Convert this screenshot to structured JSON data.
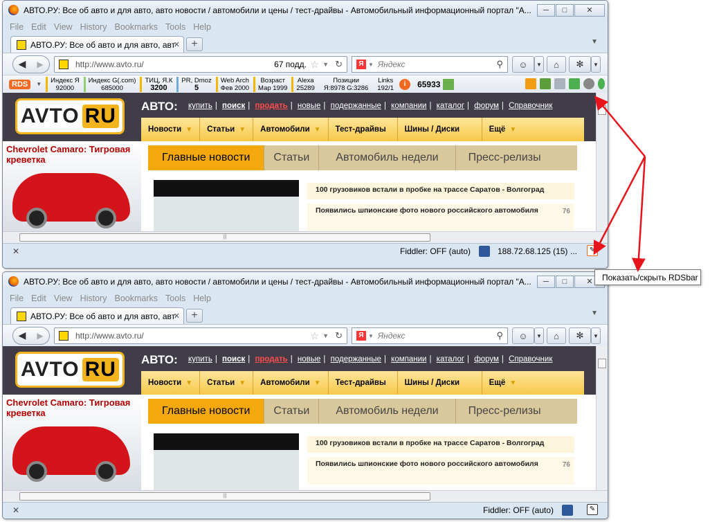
{
  "window_title": "АВТО.РУ: Все об авто и для авто, авто новости / автомобили и цены / тест-драйвы - Автомобильный информационный портал \"А...",
  "menu": [
    "File",
    "Edit",
    "View",
    "History",
    "Bookmarks",
    "Tools",
    "Help"
  ],
  "tab_title": "АВТО.РУ: Все об авто и для авто, авто н...",
  "url": "http://www.avto.ru/",
  "url_pod": "67 подд.",
  "search_placeholder": "Яндекс",
  "rdsbar": {
    "logo": "RDS",
    "items": [
      {
        "label": "Индекс Я",
        "value": "92000",
        "color": "#f5b800"
      },
      {
        "label": "Индекс G(.com)",
        "value": "685000",
        "color": "#8fcf6f"
      },
      {
        "label": "ТИЦ, Я.К",
        "value": "3200",
        "color": "#f5b800"
      },
      {
        "label": "PR, Dmoz",
        "value": "5",
        "color": "#6fa9e0"
      },
      {
        "label": "Web Arch",
        "value": "Фев 2000",
        "color": "#f5b800"
      },
      {
        "label": "Возраст",
        "value": "Мар 1999",
        "color": "#f5b800"
      },
      {
        "label": "Alexa",
        "value": "25289",
        "color": "#f5b800"
      },
      {
        "label": "Позиции",
        "value": "Я:8978 G:3286",
        "color": "#ffffff"
      },
      {
        "label": "Links",
        "value": "192/1",
        "color": "#ffffff"
      }
    ],
    "counter": "65933"
  },
  "site": {
    "avto_label": "АВТО:",
    "top_links": [
      "купить",
      "поиск",
      "продать",
      "новые",
      "подержанные",
      "компании",
      "каталог",
      "форум",
      "Справочник"
    ],
    "logo_left": "AVTO",
    "logo_right": "RU",
    "nav": [
      "Новости",
      "Статьи",
      "Автомобили",
      "Тест-драйвы",
      "Шины / Диски",
      "Ещё"
    ],
    "promo_title": "Chevrolet Camaro: Тигровая креветка",
    "news_tabs": [
      "Главные новости",
      "Статьи",
      "Автомобиль недели",
      "Пресс-релизы"
    ],
    "news_1": "100 грузовиков встали в пробке на трассе Саратов - Волгоград",
    "news_2": "Появились шпионские фото нового российского автомобиля",
    "news_2_count": "76"
  },
  "status": {
    "fiddler": "Fiddler: OFF (auto)",
    "ip": "188.72.68.125 (15)",
    "dots": "..."
  },
  "tooltip": "Показать/скрыть RDSbar",
  "colors": {
    "arrow": "#e8141b",
    "accent": "#f3a90e",
    "site_bg": "#403c48"
  }
}
